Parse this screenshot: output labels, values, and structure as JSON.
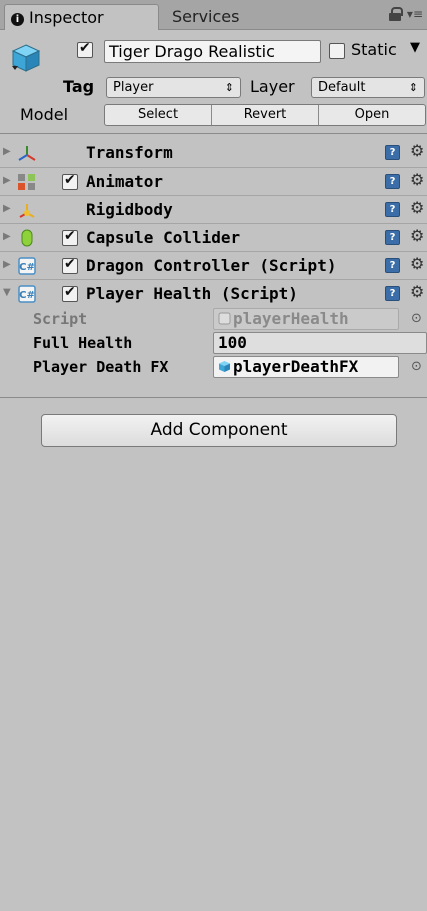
{
  "tabs": {
    "inspector": "Inspector",
    "services": "Services"
  },
  "object": {
    "name": "Tiger Drago Realistic",
    "active": true,
    "static_label": "Static",
    "static": false,
    "tag_label": "Tag",
    "tag_value": "Player",
    "layer_label": "Layer",
    "layer_value": "Default",
    "model_label": "Model",
    "model_buttons": [
      "Select",
      "Revert",
      "Open"
    ]
  },
  "components": [
    {
      "name": "Transform",
      "icon": "transform-icon",
      "has_checkbox": false
    },
    {
      "name": "Animator",
      "icon": "animator-icon",
      "has_checkbox": true,
      "enabled": true
    },
    {
      "name": "Rigidbody",
      "icon": "rigidbody-icon",
      "has_checkbox": false
    },
    {
      "name": "Capsule Collider",
      "icon": "capsule-collider-icon",
      "has_checkbox": true,
      "enabled": true
    },
    {
      "name": "Dragon Controller (Script)",
      "icon": "csharp-script-icon",
      "has_checkbox": true,
      "enabled": true
    },
    {
      "name": "Player Health (Script)",
      "icon": "csharp-script-icon",
      "has_checkbox": true,
      "enabled": true,
      "expanded": true
    }
  ],
  "player_health": {
    "script_label": "Script",
    "script_value": "playerHealth",
    "full_health_label": "Full Health",
    "full_health_value": "100",
    "death_fx_label": "Player Death FX",
    "death_fx_value": "playerDeathFX"
  },
  "add_component_label": "Add Component",
  "colors": {
    "panel_bg": "#c2c2c2",
    "tab_bar_bg": "#a5a5a5",
    "help_icon": "#3b6ea8"
  }
}
